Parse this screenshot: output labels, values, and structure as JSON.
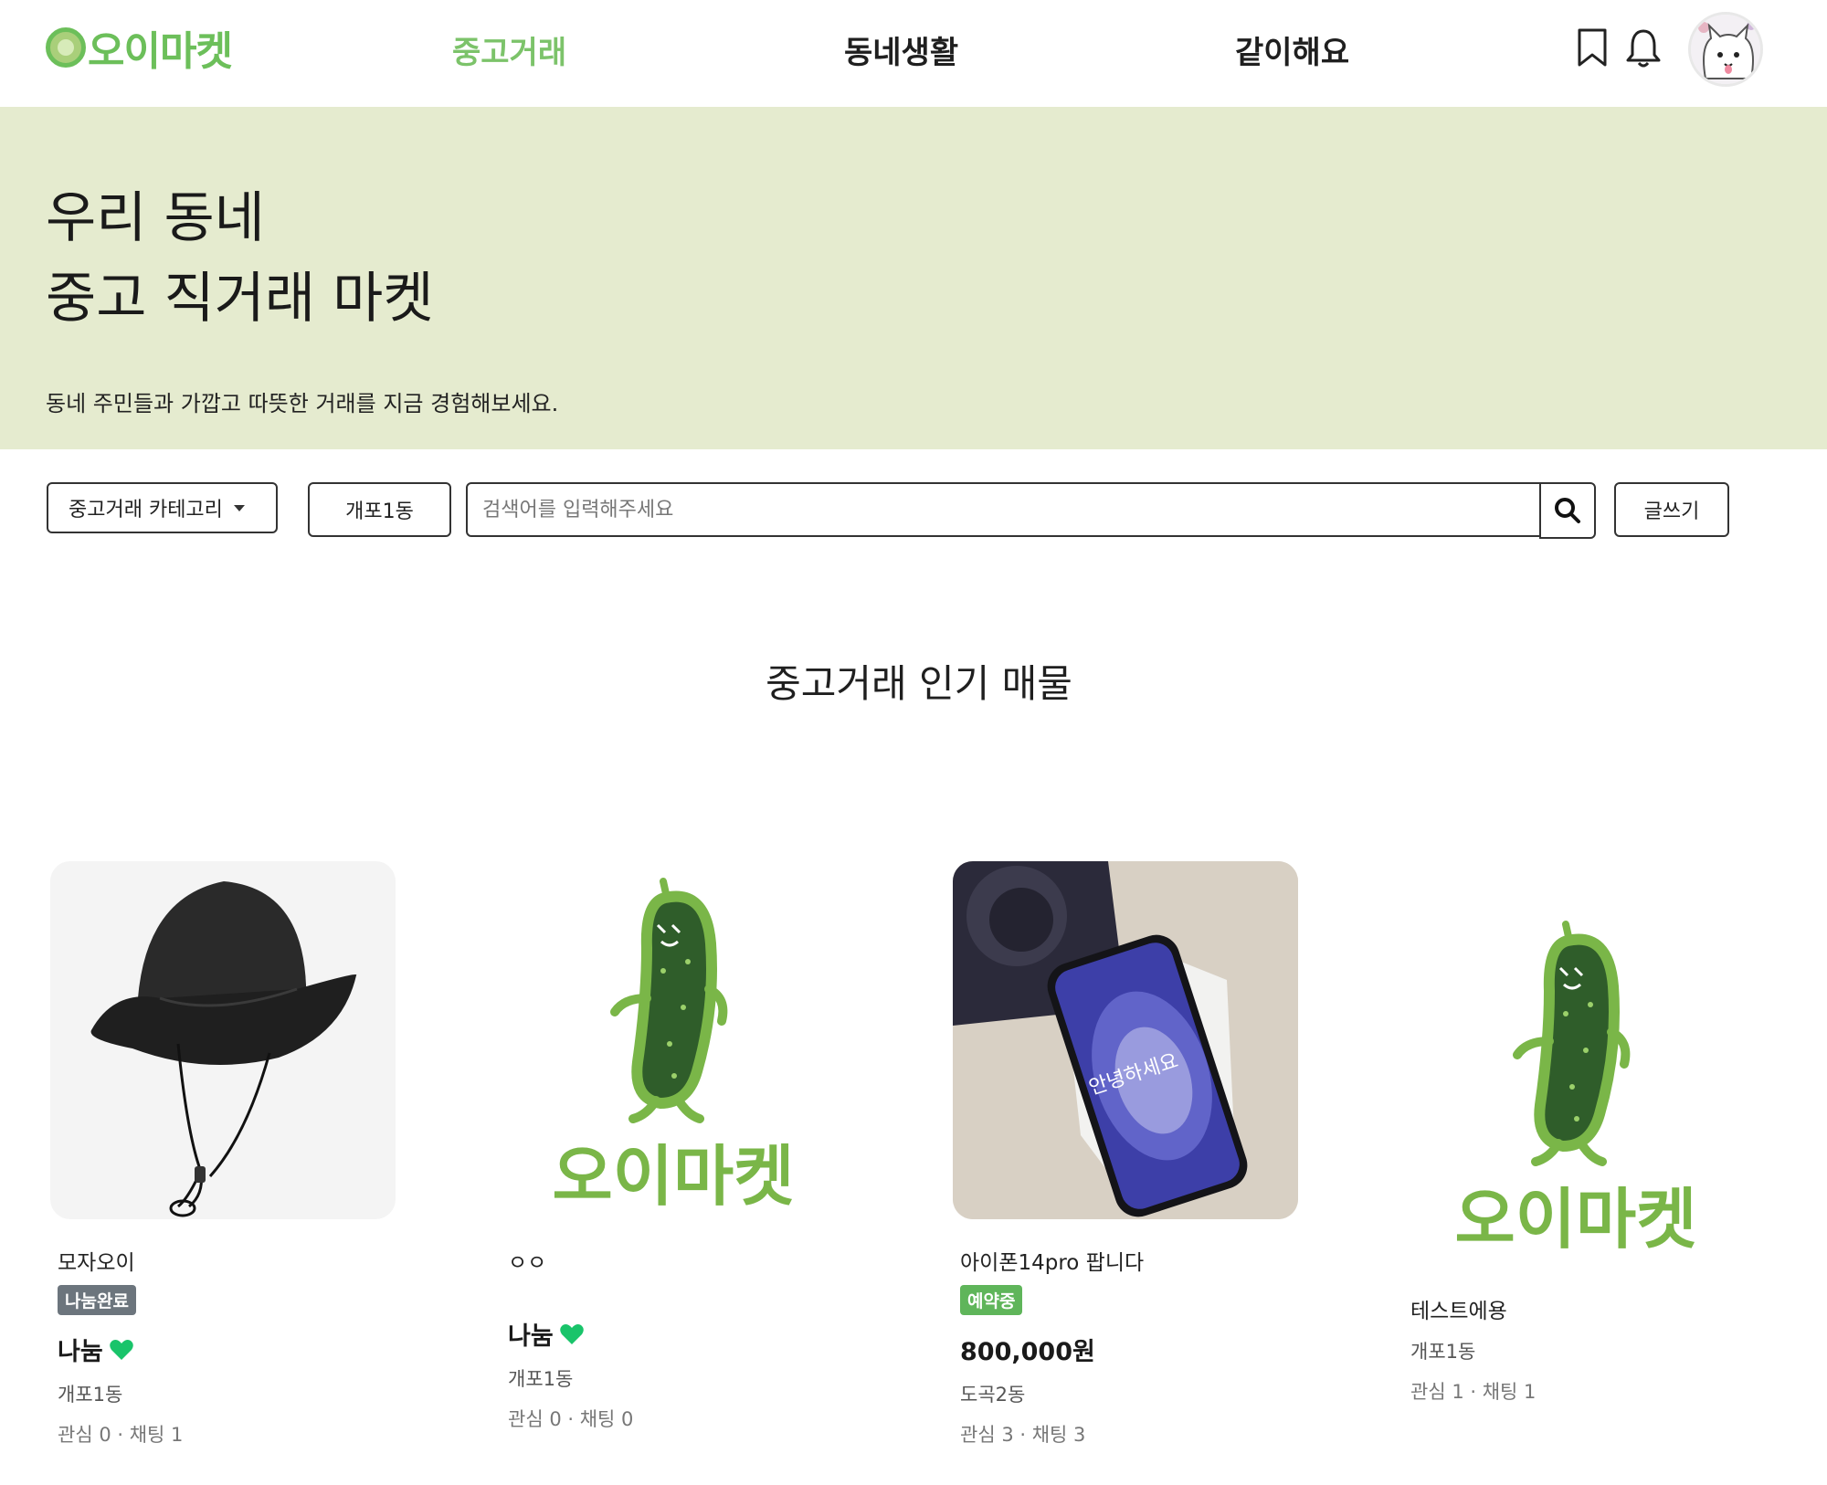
{
  "header": {
    "logo_text": "오이마켓",
    "nav": [
      "중고거래",
      "동네생활",
      "같이해요"
    ],
    "active_nav": "중고거래",
    "accent_color": "#7cc36a"
  },
  "hero": {
    "title_line1": "우리 동네",
    "title_line2": "중고 직거래 마켓",
    "subtitle": "동네 주민들과 가깝고 따뜻한 거래를 지금 경험해보세요.",
    "background": "#e5ebcf"
  },
  "search": {
    "category_label": "중고거래 카테고리",
    "region_label": "개포1동",
    "placeholder": "검색어를 입력해주세요",
    "write_label": "글쓰기"
  },
  "section_title": "중고거래 인기 매물",
  "products": [
    {
      "title": "모자오이",
      "badge": "나눔완료",
      "badge_color": "#6c757d",
      "price": "나눔",
      "heart": true,
      "location": "개포1동",
      "stats": "관심 0 · 채팅 1",
      "image": "black-bucket-hat"
    },
    {
      "title": "ㅇㅇ",
      "badge": "",
      "price": "나눔",
      "heart": true,
      "location": "개포1동",
      "stats": "관심 0 · 채팅 0",
      "image": "oimarket-logo"
    },
    {
      "title": "아이폰14pro 팝니다",
      "badge": "예약중",
      "badge_color": "#5fb55a",
      "price": "800,000원",
      "heart": false,
      "location": "도곡2동",
      "stats": "관심 3 · 채팅 3",
      "image": "iphone-photo",
      "phone_screen_text": "안녕하세요"
    },
    {
      "title": "테스트에용",
      "badge": "",
      "price": "",
      "heart": false,
      "location": "개포1동",
      "stats": "관심 1 · 채팅 1",
      "image": "oimarket-logo"
    }
  ]
}
